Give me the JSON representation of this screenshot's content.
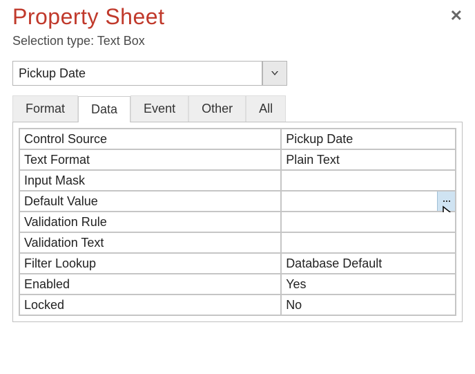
{
  "header": {
    "title": "Property Sheet",
    "subtitle": "Selection type: Text Box"
  },
  "control_select": {
    "value": "Pickup Date"
  },
  "tabs": [
    {
      "label": "Format"
    },
    {
      "label": "Data",
      "active": true
    },
    {
      "label": "Event"
    },
    {
      "label": "Other"
    },
    {
      "label": "All"
    }
  ],
  "properties": [
    {
      "label": "Control Source",
      "value": "Pickup Date"
    },
    {
      "label": "Text Format",
      "value": "Plain Text"
    },
    {
      "label": "Input Mask",
      "value": ""
    },
    {
      "label": "Default Value",
      "value": "",
      "builder": true,
      "cursor": true
    },
    {
      "label": "Validation Rule",
      "value": ""
    },
    {
      "label": "Validation Text",
      "value": ""
    },
    {
      "label": "Filter Lookup",
      "value": "Database Default"
    },
    {
      "label": "Enabled",
      "value": "Yes"
    },
    {
      "label": "Locked",
      "value": "No"
    }
  ]
}
